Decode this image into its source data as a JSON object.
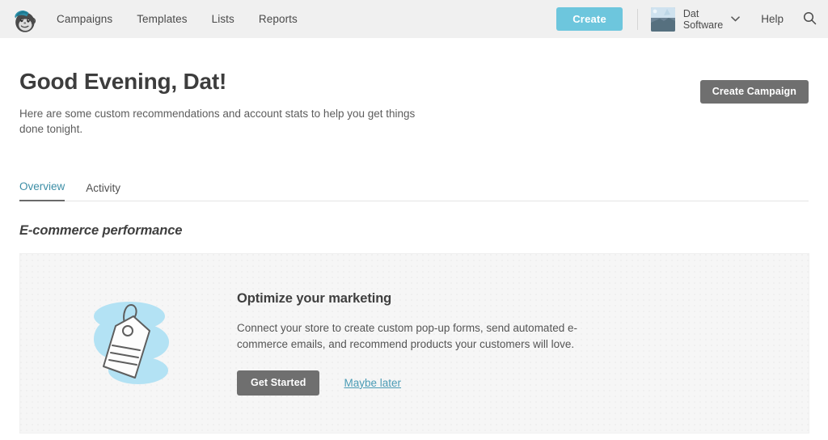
{
  "header": {
    "logo_icon": "mailchimp-freddie-logo",
    "nav_items": [
      {
        "label": "Campaigns"
      },
      {
        "label": "Templates"
      },
      {
        "label": "Lists"
      },
      {
        "label": "Reports"
      }
    ],
    "create_label": "Create",
    "account": {
      "name_line1": "Dat",
      "name_line2": "Software",
      "chevron_icon": "chevron-down-icon",
      "avatar_icon": "user-avatar-photo"
    },
    "help_label": "Help",
    "search_icon": "search-icon",
    "background_color": "#f0f0f0",
    "create_button_color": "#6dc6dd"
  },
  "hero": {
    "greeting": "Good Evening, Dat!",
    "subtitle": "Here are some custom recommendations and account stats to help you get things done tonight.",
    "create_campaign_label": "Create Campaign",
    "button_color": "#6f6f6f"
  },
  "tabs": {
    "items": [
      {
        "label": "Overview",
        "active": true
      },
      {
        "label": "Activity",
        "active": false
      }
    ],
    "active_color": "#3c8ea6",
    "underline_color": "#6a6a6a"
  },
  "section": {
    "title": "E-commerce performance"
  },
  "card": {
    "illustration_icon": "price-tag-illustration",
    "illustration_blob_color": "#b3e2f4",
    "heading": "Optimize your marketing",
    "text": "Connect your store to create custom pop-up forms, send automated e-commerce emails, and recommend products your customers will love.",
    "primary_action_label": "Get Started",
    "secondary_action_label": "Maybe later",
    "background_color": "#f6f6f6",
    "link_color": "#4a9bb5"
  }
}
